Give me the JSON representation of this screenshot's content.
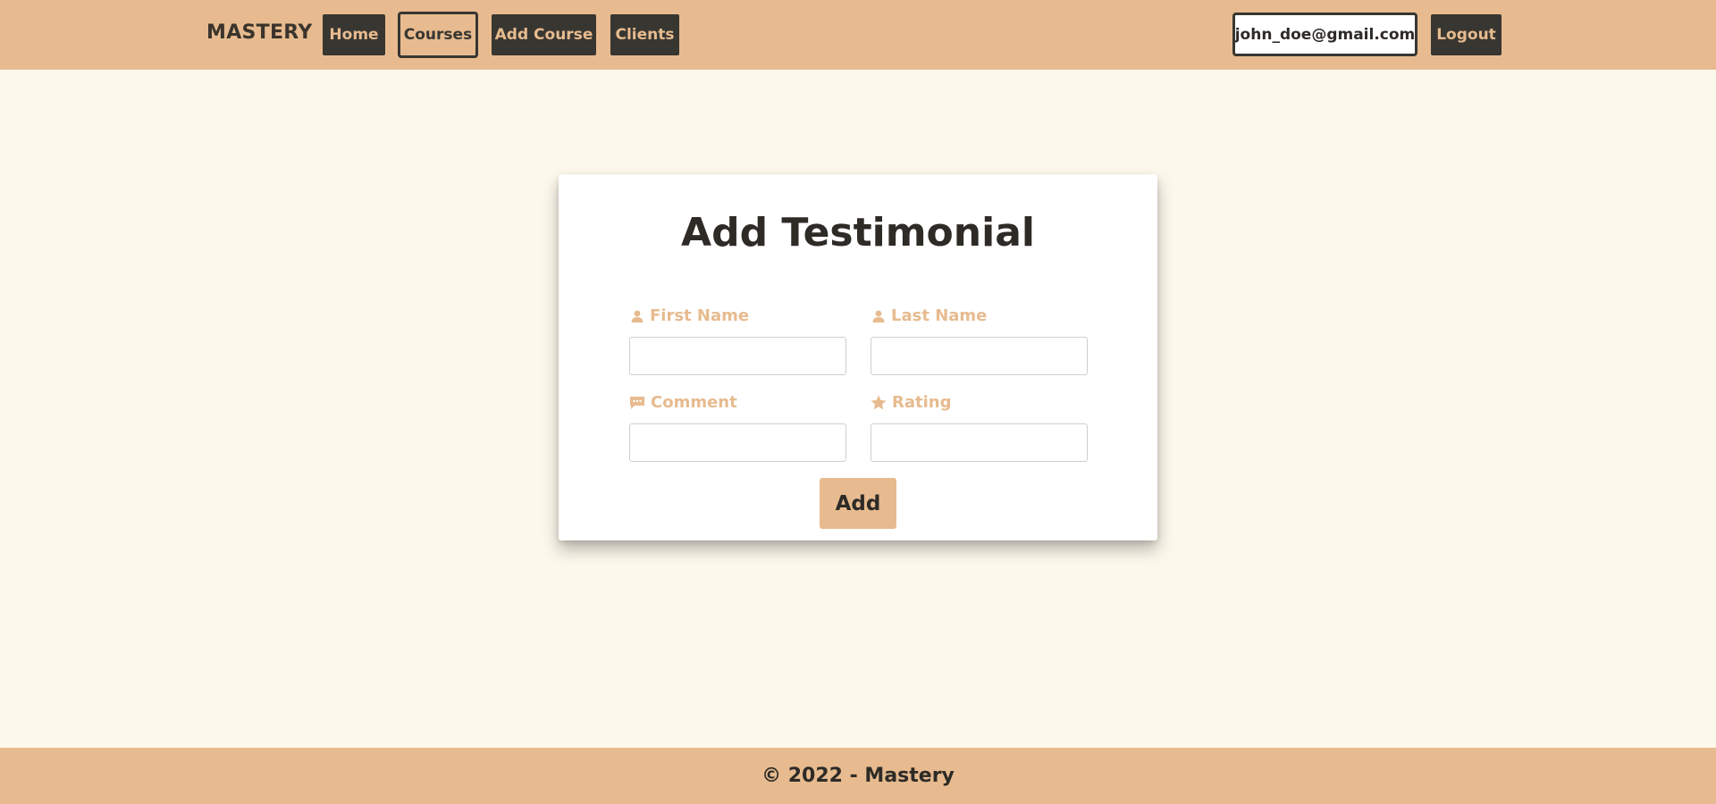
{
  "navbar": {
    "brand": "MASTERY",
    "items": [
      {
        "label": "Home",
        "active": false
      },
      {
        "label": "Courses",
        "active": true
      },
      {
        "label": "Add Course",
        "active": false
      },
      {
        "label": "Clients",
        "active": false
      }
    ],
    "user_email": "john_doe@gmail.com",
    "logout_label": "Logout"
  },
  "form": {
    "title": "Add Testimonial",
    "fields": [
      {
        "label": "First Name",
        "icon": "user-icon",
        "value": ""
      },
      {
        "label": "Last Name",
        "icon": "user-icon",
        "value": ""
      },
      {
        "label": "Comment",
        "icon": "comment-icon",
        "value": ""
      },
      {
        "label": "Rating",
        "icon": "star-icon",
        "value": ""
      }
    ],
    "submit_label": "Add"
  },
  "footer": {
    "text": "© 2022 - Mastery"
  },
  "colors": {
    "accent": "#e7bb8f",
    "dark": "#383631",
    "background": "#fdf8ec"
  }
}
